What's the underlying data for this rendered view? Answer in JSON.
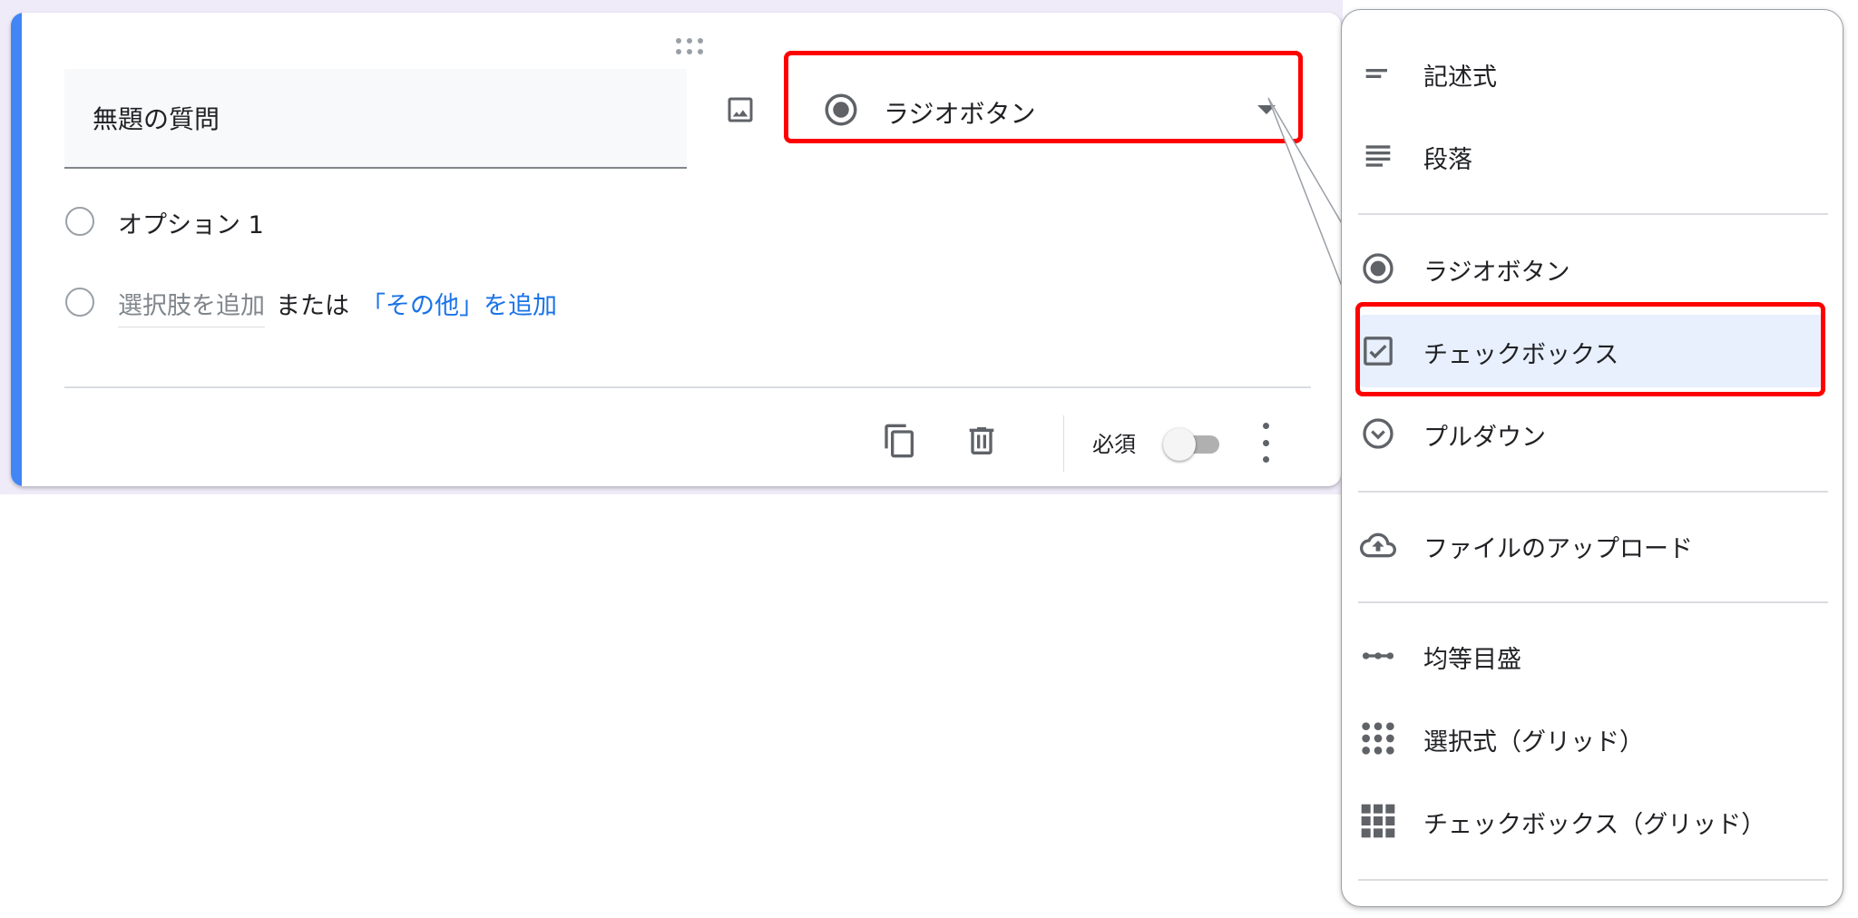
{
  "question": {
    "title": "無題の質問",
    "type_label": "ラジオボタン",
    "options": [
      {
        "label": "オプション 1"
      }
    ],
    "add_option_label": "選択肢を追加",
    "or_label": "または",
    "add_other_label": "「その他」を追加",
    "required_label": "必須",
    "required": false
  },
  "icons": {
    "drag": "drag-handle-icon",
    "image": "image-icon",
    "copy": "copy-icon",
    "delete": "trash-icon",
    "more": "more-vert-icon"
  },
  "type_menu": {
    "items": [
      {
        "label": "記述式",
        "icon": "short-answer-icon"
      },
      {
        "label": "段落",
        "icon": "paragraph-icon"
      },
      {
        "label": "ラジオボタン",
        "icon": "radio-button-icon"
      },
      {
        "label": "チェックボックス",
        "icon": "checkbox-icon",
        "highlighted": true
      },
      {
        "label": "プルダウン",
        "icon": "dropdown-icon"
      },
      {
        "label": "ファイルのアップロード",
        "icon": "cloud-upload-icon"
      },
      {
        "label": "均等目盛",
        "icon": "linear-scale-icon"
      },
      {
        "label": "選択式（グリッド）",
        "icon": "radio-grid-icon"
      },
      {
        "label": "チェックボックス（グリッド）",
        "icon": "checkbox-grid-icon"
      }
    ]
  },
  "colors": {
    "accent": "#4285f4",
    "link": "#1a73e8",
    "highlight": "#ff0000",
    "selected_bg": "#e8f0fe",
    "page_bg": "#f0ebf8"
  }
}
